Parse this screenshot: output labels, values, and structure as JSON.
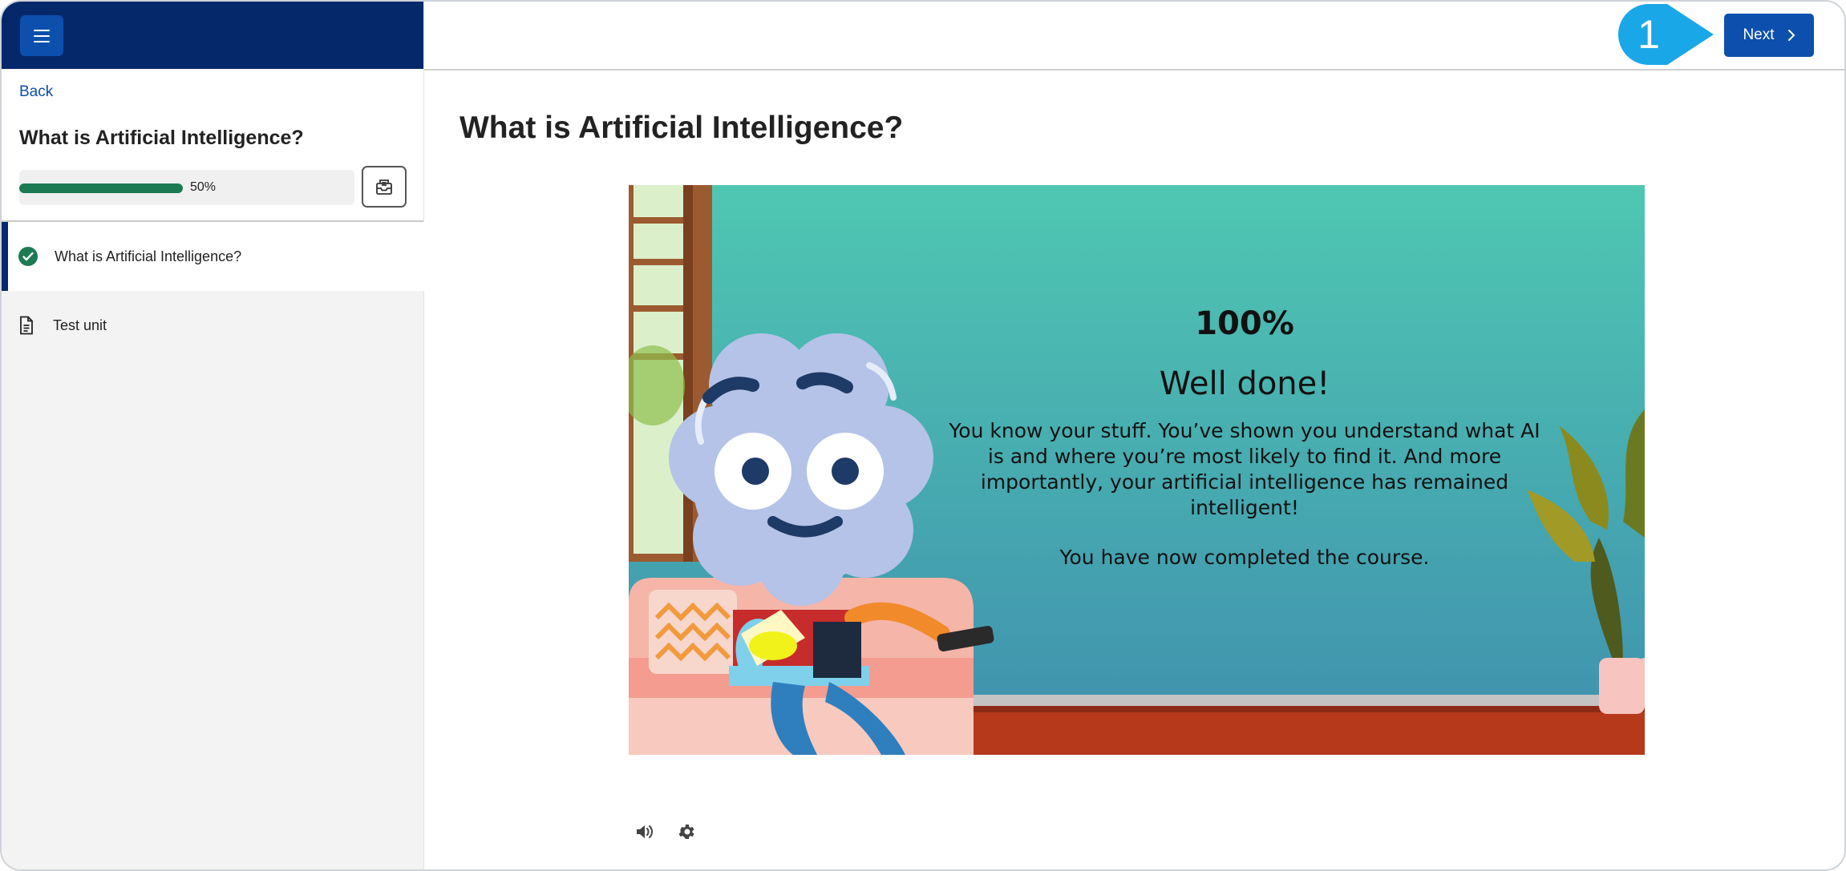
{
  "sidebar": {
    "back_label": "Back",
    "course_title": "What is Artificial Intelligence?",
    "progress": {
      "percent": 50,
      "label": "50%"
    },
    "items": [
      {
        "label": "What is Artificial Intelligence?",
        "status": "completed",
        "icon": "check-circle-icon"
      },
      {
        "label": "Test unit",
        "status": "pending",
        "icon": "document-icon"
      }
    ]
  },
  "header": {
    "next_label": "Next",
    "callout_number": "1"
  },
  "main": {
    "title": "What is Artificial Intelligence?",
    "slide": {
      "score": "100%",
      "heading": "Well done!",
      "message": "You know your stuff. You’ve shown you understand what AI is and where you’re most likely to find it. And more importantly, your artificial intelligence has remained intelligent!",
      "completion": "You have now completed the course."
    }
  },
  "colors": {
    "brand_dark": "#05286b",
    "brand_blue": "#0d4fad",
    "progress_green": "#1d7a53",
    "callout": "#1aa7e8",
    "slide_top": "#4fc7b2",
    "slide_bottom": "#3f8fae"
  }
}
